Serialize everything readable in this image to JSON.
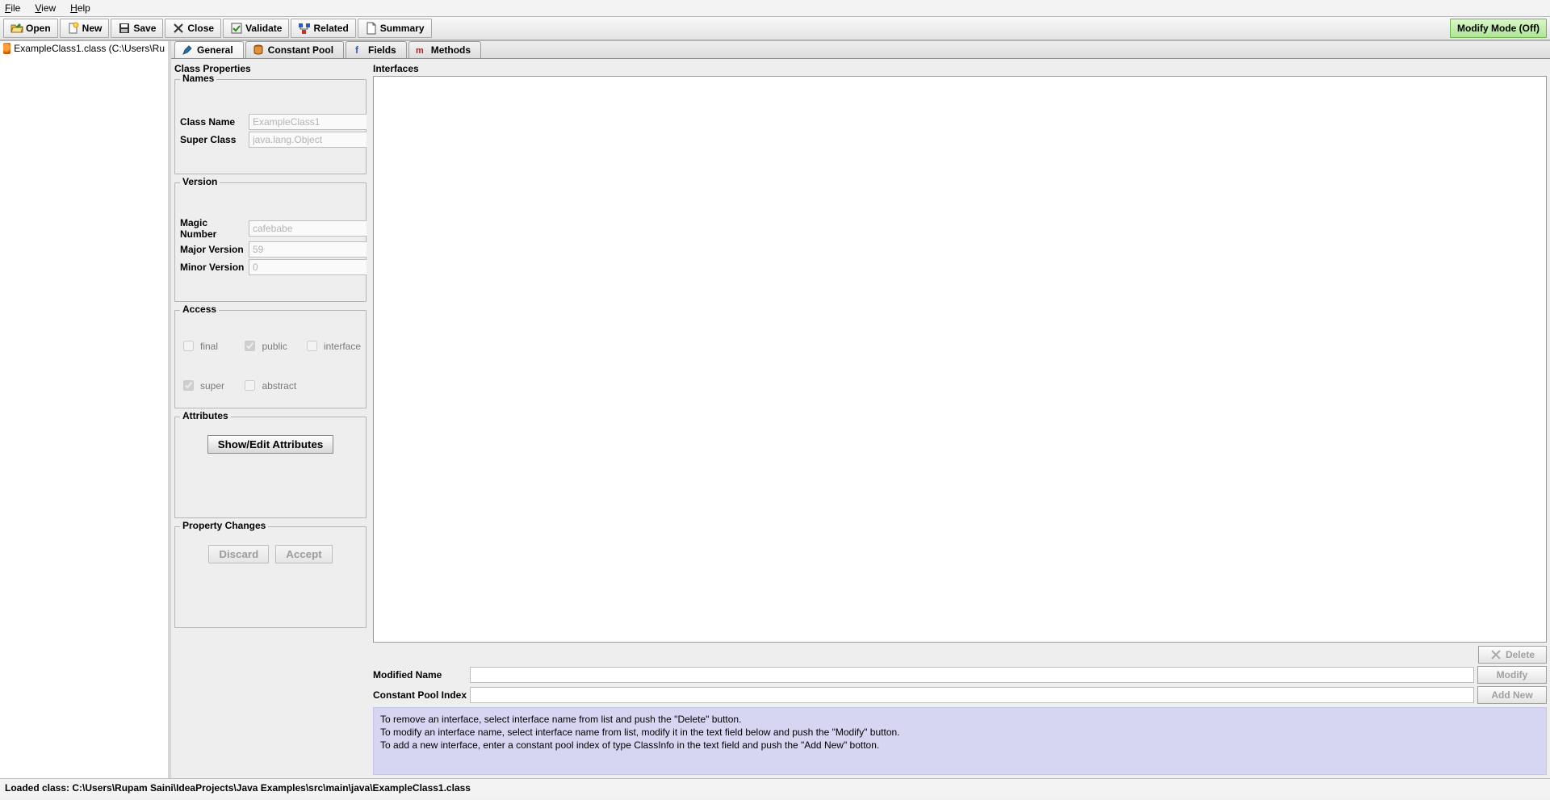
{
  "menu": {
    "file": "File",
    "view": "View",
    "help": "Help"
  },
  "toolbar": {
    "open": "Open",
    "new": "New",
    "save": "Save",
    "close": "Close",
    "validate": "Validate",
    "related": "Related",
    "summary": "Summary",
    "modify_mode": "Modify Mode (Off)"
  },
  "tree": {
    "root": "ExampleClass1.class (C:\\Users\\Ru"
  },
  "tabs": {
    "general": "General",
    "constant_pool": "Constant Pool",
    "fields": "Fields",
    "methods": "Methods"
  },
  "class_props_title": "Class Properties",
  "names": {
    "legend": "Names",
    "class_name_label": "Class Name",
    "class_name": "ExampleClass1",
    "super_class_label": "Super Class",
    "super_class": "java.lang.Object"
  },
  "version": {
    "legend": "Version",
    "magic_label": "Magic Number",
    "magic": "cafebabe",
    "major_label": "Major Version",
    "major": "59",
    "minor_label": "Minor Version",
    "minor": "0"
  },
  "access": {
    "legend": "Access",
    "final": "final",
    "public": "public",
    "interface": "interface",
    "super": "super",
    "abstract": "abstract",
    "checked_public": true,
    "checked_super": true
  },
  "attributes": {
    "legend": "Attributes",
    "button": "Show/Edit Attributes"
  },
  "property_changes": {
    "legend": "Property Changes",
    "discard": "Discard",
    "accept": "Accept"
  },
  "interfaces": {
    "title": "Interfaces",
    "delete": "Delete",
    "modified_name_label": "Modified Name",
    "modified_name": "",
    "modify": "Modify",
    "cpi_label": "Constant Pool Index",
    "cpi": "",
    "add_new": "Add New",
    "help1": "To remove an interface, select interface name from list and push the \"Delete\" button.",
    "help2": "To modify an interface name, select interface name from list, modify it in the text field below and push the \"Modify\" button.",
    "help3": "To add a new interface, enter a constant pool index of type ClassInfo in the text field and push the \"Add New\" botton."
  },
  "status": "Loaded class: C:\\Users\\Rupam Saini\\IdeaProjects\\Java Examples\\src\\main\\java\\ExampleClass1.class"
}
